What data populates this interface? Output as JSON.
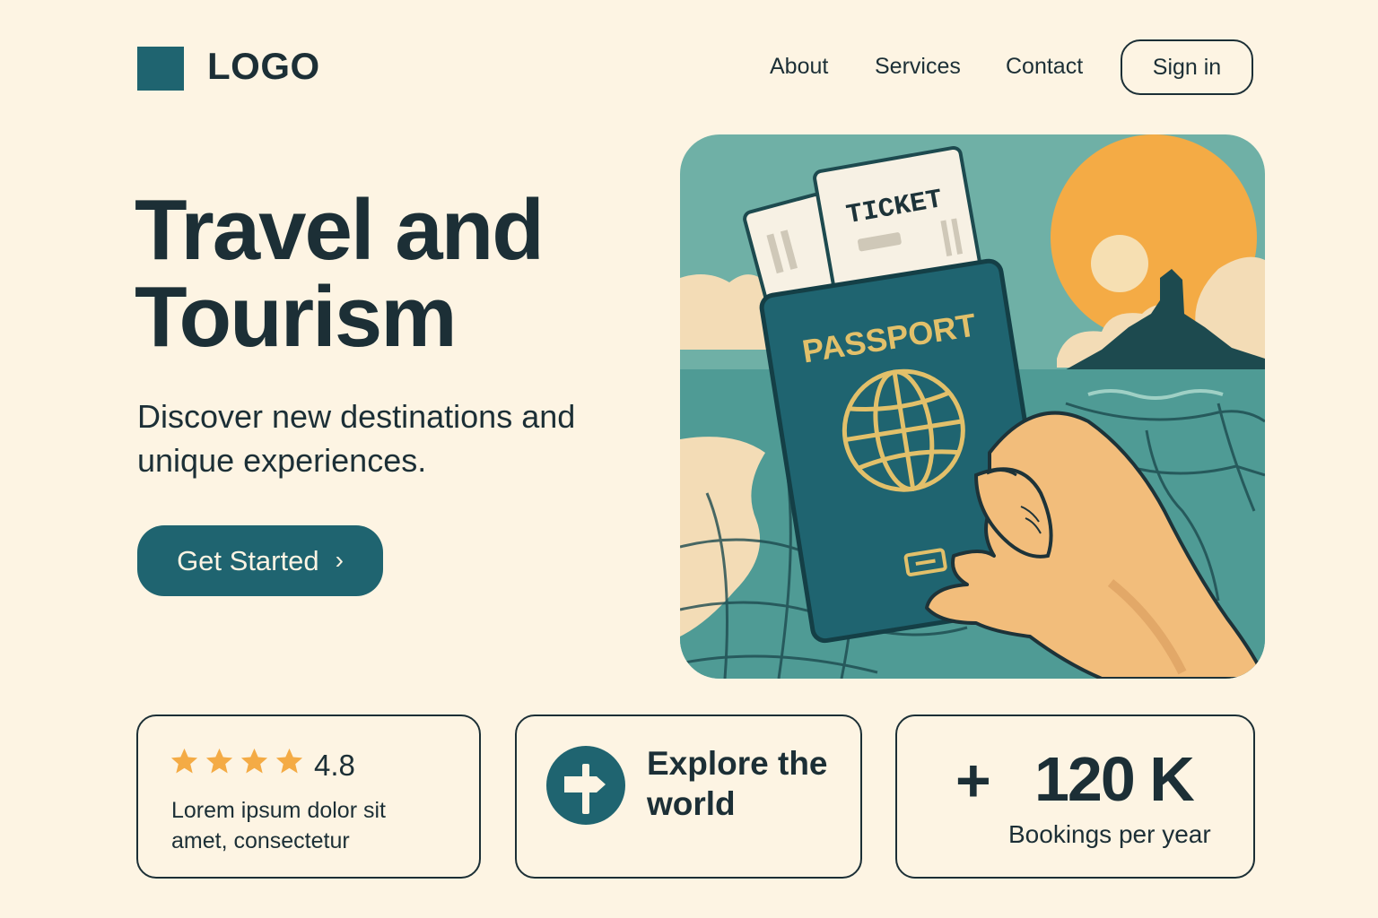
{
  "header": {
    "logo_text": "LOGO",
    "nav": [
      {
        "label": "About"
      },
      {
        "label": "Services"
      },
      {
        "label": "Contact"
      }
    ],
    "signin_label": "Sign in"
  },
  "hero": {
    "title": "Travel and Tourism",
    "subtitle": "Discover new destinations and unique experiences.",
    "cta_label": "Get Started",
    "illustration": {
      "ticket_text": "TICKET",
      "passport_text": "PASSPORT"
    }
  },
  "cards": {
    "rating": {
      "stars": 4,
      "value": "4.8",
      "text": "Lorem ipsum dolor sit amet, consectetur"
    },
    "explore": {
      "icon": "signpost-icon",
      "text": "Explore the world"
    },
    "bookings": {
      "prefix": "+",
      "value": "120 K",
      "label": "Bookings per year"
    }
  },
  "colors": {
    "background": "#fdf4e3",
    "primary": "#1f6470",
    "text": "#1c2f36",
    "accent": "#f4ab45",
    "sea": "#5fa69f",
    "gold": "#e2c06a"
  }
}
